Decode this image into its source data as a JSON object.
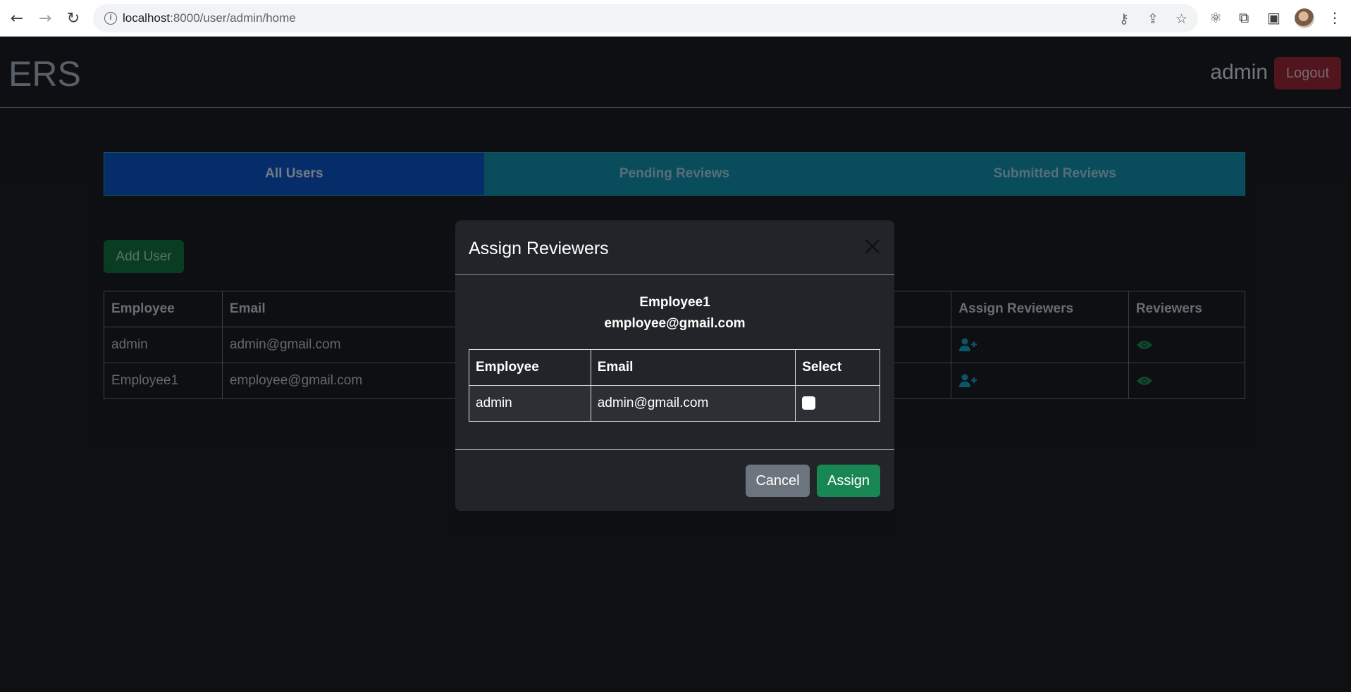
{
  "browser": {
    "url_host": "localhost",
    "url_path": ":8000/user/admin/home",
    "icons": [
      "back-icon",
      "forward-icon",
      "reload-icon",
      "site-info-icon",
      "key-icon",
      "share-icon",
      "bookmark-star-icon",
      "react-devtools-icon",
      "extensions-icon",
      "side-panel-icon",
      "profile-avatar",
      "menu-kebab-icon"
    ]
  },
  "header": {
    "brand": "ERS",
    "username": "admin",
    "logout_label": "Logout"
  },
  "tabs": [
    {
      "label": "All Users",
      "active": true
    },
    {
      "label": "Pending Reviews",
      "active": false
    },
    {
      "label": "Submitted Reviews",
      "active": false
    }
  ],
  "add_user_label": "Add User",
  "users_table": {
    "headers": {
      "employee": "Employee",
      "email": "Email",
      "assign": "Assign Reviewers",
      "reviewers": "Reviewers"
    },
    "rows": [
      {
        "employee": "admin",
        "email": "admin@gmail.com"
      },
      {
        "employee": "Employee1",
        "email": "employee@gmail.com"
      }
    ]
  },
  "modal": {
    "title": "Assign Reviewers",
    "target_name": "Employee1",
    "target_email": "employee@gmail.com",
    "table": {
      "headers": {
        "employee": "Employee",
        "email": "Email",
        "select": "Select"
      },
      "rows": [
        {
          "employee": "admin",
          "email": "admin@gmail.com",
          "selected": false
        }
      ]
    },
    "cancel_label": "Cancel",
    "assign_label": "Assign"
  },
  "colors": {
    "assign_icon": "#0b6a80",
    "reviewers_icon": "#0f5a3a"
  }
}
